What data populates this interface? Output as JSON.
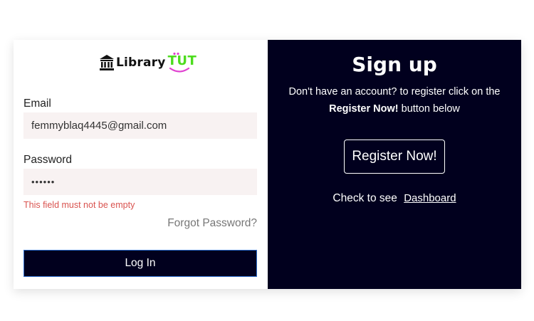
{
  "logo": {
    "word": "Library",
    "accent": "TUT"
  },
  "login": {
    "email_label": "Email",
    "email_value": "femmyblaq4445@gmail.com",
    "password_label": "Password",
    "password_value": "••••••",
    "error_text": "This field must not be empty",
    "forgot_text": "Forgot Password?",
    "login_button": "Log In"
  },
  "signup": {
    "title": "Sign up",
    "desc_line1": "Don't have an account? to register click on the",
    "desc_bold": "Register Now!",
    "desc_tail": " button below",
    "register_button": "Register Now!",
    "check_text": "Check to see",
    "dashboard_link": "Dashboard"
  },
  "colors": {
    "panel_dark": "#01001e",
    "input_bg": "#f8f2f2",
    "error": "#d9534f",
    "logo_green": "#4ddc1e",
    "logo_pink": "#e040d0"
  }
}
